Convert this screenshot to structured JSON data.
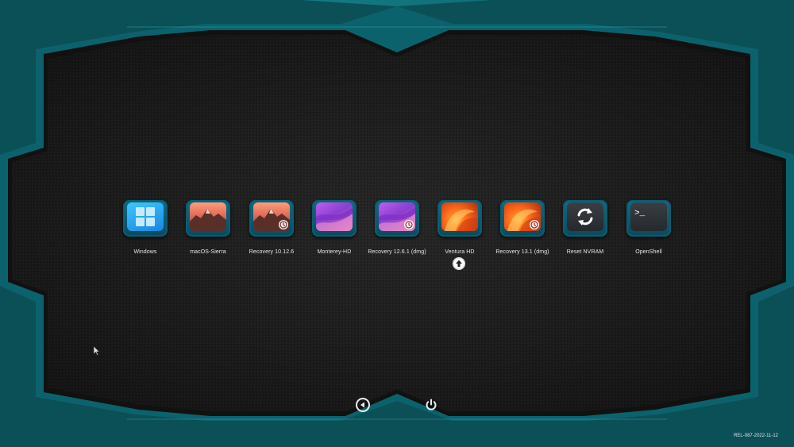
{
  "entries": [
    {
      "label": "Windows",
      "icon": "windows-icon",
      "style": "win",
      "badge": false,
      "default": false
    },
    {
      "label": "macOS-Sierra",
      "icon": "macos-sierra-icon",
      "style": "sierra",
      "badge": false,
      "default": false
    },
    {
      "label": "Recovery 10.12.6",
      "icon": "macos-sierra-recovery-icon",
      "style": "sierra",
      "badge": true,
      "default": false
    },
    {
      "label": "Monterey-HD",
      "icon": "macos-monterey-icon",
      "style": "monterey",
      "badge": false,
      "default": false
    },
    {
      "label": "Recovery 12.6.1 (dmg)",
      "icon": "macos-monterey-recovery-icon",
      "style": "monterey",
      "badge": true,
      "default": false
    },
    {
      "label": "Ventura HD",
      "icon": "macos-ventura-icon",
      "style": "ventura",
      "badge": false,
      "default": true
    },
    {
      "label": "Recovery 13.1 (dmg)",
      "icon": "macos-ventura-recovery-icon",
      "style": "ventura",
      "badge": true,
      "default": false
    },
    {
      "label": "Reset NVRAM",
      "icon": "reset-nvram-icon",
      "style": "tool",
      "badge": false,
      "default": false
    },
    {
      "label": "OpenShell",
      "icon": "terminal-icon",
      "style": "tool",
      "badge": false,
      "default": false
    }
  ],
  "controls": {
    "back_icon": "back-arrow-icon",
    "power_icon": "power-icon"
  },
  "version_text": "REL-087-2022-11-12",
  "colors": {
    "frame_teal": "#0c6f79",
    "background": "#2a2a2a",
    "text": "#e6e6e6"
  }
}
